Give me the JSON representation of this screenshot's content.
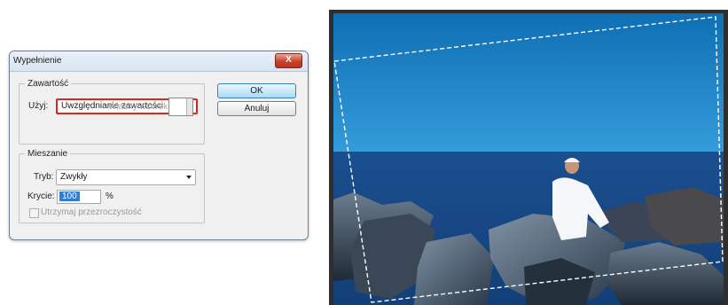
{
  "dialog": {
    "title": "Wypełnienie",
    "close_label": "X",
    "content_group": {
      "legend": "Zawartość",
      "use_label": "Użyj:",
      "use_value": "Uwzględnianie zawartości",
      "custom_pattern_label": "Własny wzorek:"
    },
    "blending_group": {
      "legend": "Mieszanie",
      "mode_label": "Tryb:",
      "mode_value": "Zwykły",
      "opacity_label": "Krycie:",
      "opacity_value": "100",
      "opacity_unit": "%",
      "preserve_transparency_label": "Utrzymaj przezroczystość",
      "preserve_transparency_checked": false
    },
    "buttons": {
      "ok": "OK",
      "cancel": "Anuluj"
    }
  },
  "colors": {
    "highlight_border": "#d8271c",
    "primary_button": "#a9dbf6",
    "selected_text_bg": "#2f7fd8",
    "sky_top": "#0f6fb4",
    "sea": "#123f78"
  }
}
